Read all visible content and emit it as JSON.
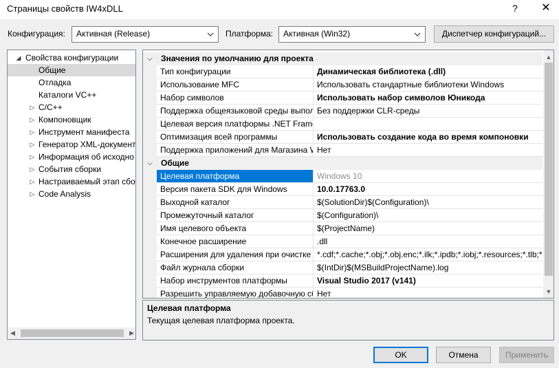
{
  "window": {
    "title": "Страницы свойств IW4xDLL",
    "help_glyph": "?",
    "close_glyph": "✕"
  },
  "toolbar": {
    "config_label": "Конфигурация:",
    "config_value": "Активная (Release)",
    "platform_label": "Платформа:",
    "platform_value": "Активная (Win32)",
    "config_manager_label": "Диспетчер конфигураций..."
  },
  "tree": {
    "items": [
      {
        "label": "Свойства конфигурации",
        "expander": "◢",
        "level": 0
      },
      {
        "label": "Общие",
        "expander": "",
        "level": 1,
        "selected": true
      },
      {
        "label": "Отладка",
        "expander": "",
        "level": 1
      },
      {
        "label": "Каталоги VC++",
        "expander": "",
        "level": 1
      },
      {
        "label": "C/C++",
        "expander": "▷",
        "level": 1
      },
      {
        "label": "Компоновщик",
        "expander": "▷",
        "level": 1
      },
      {
        "label": "Инструмент манифеста",
        "expander": "▷",
        "level": 1
      },
      {
        "label": "Генератор XML-документ",
        "expander": "▷",
        "level": 1
      },
      {
        "label": "Информация об исходно",
        "expander": "▷",
        "level": 1
      },
      {
        "label": "События сборки",
        "expander": "▷",
        "level": 1
      },
      {
        "label": "Настраиваемый этап сбо",
        "expander": "▷",
        "level": 1
      },
      {
        "label": "Code Analysis",
        "expander": "▷",
        "level": 1
      }
    ]
  },
  "grid": {
    "rows": [
      {
        "type": "category",
        "label": "Значения по умолчанию для проекта",
        "toggle": "⌵"
      },
      {
        "type": "prop",
        "name": "Тип конфигурации",
        "value": "Динамическая библиотека (.dll)",
        "bold": true
      },
      {
        "type": "prop",
        "name": "Использование MFC",
        "value": "Использовать стандартные библиотеки Windows"
      },
      {
        "type": "prop",
        "name": "Набор символов",
        "value": "Использовать набор символов Юникода",
        "bold": true
      },
      {
        "type": "prop",
        "name": "Поддержка общеязыковой среды выпол",
        "value": "Без поддержки CLR-среды"
      },
      {
        "type": "prop",
        "name": "Целевая версия платформы .NET Framew",
        "value": ""
      },
      {
        "type": "prop",
        "name": "Оптимизация всей программы",
        "value": "Использовать создание кода во время компоновки",
        "bold": true
      },
      {
        "type": "prop",
        "name": "Поддержка приложений для Магазина W",
        "value": "Нет"
      },
      {
        "type": "category",
        "label": "Общие",
        "toggle": "⌵"
      },
      {
        "type": "prop",
        "name": "Целевая платформа",
        "value": "Windows 10",
        "selected": true,
        "gray": true
      },
      {
        "type": "prop",
        "name": "Версия пакета SDK для Windows",
        "value": "10.0.17763.0",
        "bold": true
      },
      {
        "type": "prop",
        "name": "Выходной каталог",
        "value": "$(SolutionDir)$(Configuration)\\"
      },
      {
        "type": "prop",
        "name": "Промежуточный каталог",
        "value": "$(Configuration)\\"
      },
      {
        "type": "prop",
        "name": "Имя целевого объекта",
        "value": "$(ProjectName)"
      },
      {
        "type": "prop",
        "name": "Конечное расширение",
        "value": ".dll"
      },
      {
        "type": "prop",
        "name": "Расширения для удаления при очистке",
        "value": "*.cdf;*.cache;*.obj;*.obj.enc;*.ilk;*.ipdb;*.iobj;*.resources;*.tlb;*"
      },
      {
        "type": "prop",
        "name": "Файл журнала сборки",
        "value": "$(IntDir)$(MSBuildProjectName).log"
      },
      {
        "type": "prop",
        "name": "Набор инструментов платформы",
        "value": "Visual Studio 2017 (v141)",
        "bold": true
      },
      {
        "type": "prop",
        "name": "Разрешить управляемую добавочную сб",
        "value": "Нет"
      }
    ]
  },
  "description": {
    "title": "Целевая платформа",
    "text": "Текущая целевая платформа проекта."
  },
  "buttons": {
    "ok": "OK",
    "cancel": "Отмена",
    "apply": "Применить"
  },
  "colors": {
    "selection": "#0078d7",
    "tree_selection": "#dadada"
  }
}
